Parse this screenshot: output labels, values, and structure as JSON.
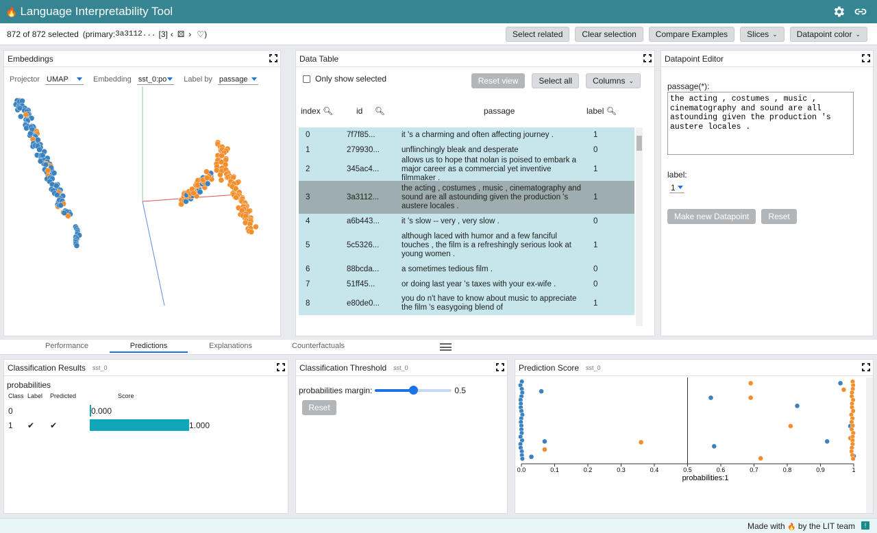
{
  "app": {
    "title": "Language Interpretability Tool",
    "logo": "flame-icon"
  },
  "status": {
    "selected_text": "872 of 872 selected",
    "primary_label": "(primary: ",
    "primary_id": "3a3112...",
    "primary_index": "[3]"
  },
  "toolbar": {
    "select_related": "Select related",
    "clear_selection": "Clear selection",
    "compare_examples": "Compare Examples",
    "slices": "Slices",
    "datapoint_color": "Datapoint color"
  },
  "embeddings": {
    "title": "Embeddings",
    "projector_label": "Projector",
    "projector_value": "UMAP",
    "embedding_label": "Embedding",
    "embedding_value": "sst_0:po",
    "label_by_label": "Label by",
    "label_by_value": "passage"
  },
  "table": {
    "title": "Data Table",
    "only_show_selected": "Only show selected",
    "reset_view": "Reset view",
    "select_all": "Select all",
    "columns": "Columns",
    "headers": {
      "index": "index",
      "id": "id",
      "passage": "passage",
      "label": "label"
    },
    "rows": [
      {
        "index": "0",
        "id": "7f7f85...",
        "passage": "it 's a charming and often affecting journey .",
        "label": "1"
      },
      {
        "index": "1",
        "id": "279930...",
        "passage": "unflinchingly bleak and desperate",
        "label": "0"
      },
      {
        "index": "2",
        "id": "345ac4...",
        "passage": "allows us to hope that nolan is poised to embark a major career as a commercial yet inventive filmmaker .",
        "label": "1"
      },
      {
        "index": "3",
        "id": "3a3112...",
        "passage": "the acting , costumes , music , cinematography and sound are all astounding given the production 's austere locales .",
        "label": "1"
      },
      {
        "index": "4",
        "id": "a6b443...",
        "passage": "it 's slow -- very , very slow .",
        "label": "0"
      },
      {
        "index": "5",
        "id": "5c5326...",
        "passage": "although laced with humor and a few fanciful touches , the film is a refreshingly serious look at young women .",
        "label": "1"
      },
      {
        "index": "6",
        "id": "88bcda...",
        "passage": "a sometimes tedious film .",
        "label": "0"
      },
      {
        "index": "7",
        "id": "51ff45...",
        "passage": "or doing last year 's taxes with your ex-wife .",
        "label": "0"
      },
      {
        "index": "8",
        "id": "e80de0...",
        "passage": "you do n't have to know about music to appreciate the film 's easygoing blend of",
        "label": "1"
      }
    ]
  },
  "editor": {
    "title": "Datapoint Editor",
    "passage_label": "passage(*):",
    "passage_value": "the acting , costumes , music , cinematography and sound are all astounding given the production 's austere locales .",
    "label_label": "label:",
    "label_value": "1",
    "make_new": "Make new Datapoint",
    "reset": "Reset"
  },
  "tabs": {
    "performance": "Performance",
    "predictions": "Predictions",
    "explanations": "Explanations",
    "counterfactuals": "Counterfactuals"
  },
  "classification": {
    "title": "Classification Results",
    "model": "sst_0",
    "field": "probabilities",
    "headers": {
      "class": "Class",
      "label": "Label",
      "predicted": "Predicted",
      "score": "Score"
    },
    "rows": [
      {
        "class": "0",
        "label": "",
        "predicted": "",
        "score": 0.0,
        "score_text": "0.000"
      },
      {
        "class": "1",
        "label": "✔",
        "predicted": "✔",
        "score": 1.0,
        "score_text": "1.000"
      }
    ]
  },
  "threshold": {
    "title": "Classification Threshold",
    "model": "sst_0",
    "slider_label": "probabilities margin:",
    "slider_value": 0.5,
    "slider_text": "0.5",
    "reset": "Reset"
  },
  "prediction": {
    "title": "Prediction Score",
    "model": "sst_0"
  },
  "footer": {
    "made_with": "Made with",
    "by": "by the LIT team"
  },
  "colors": {
    "teal": "#358593",
    "blue": "#3b83c0",
    "orange": "#f28e2b",
    "bar": "#0fa7b8"
  },
  "chart_data": {
    "type": "scatter",
    "xlabel": "probabilities:1",
    "xlim": [
      0,
      1
    ],
    "threshold": 0.5,
    "ticks": [
      "0.0",
      "0.1",
      "0.2",
      "0.3",
      "0.4",
      "0.5",
      "0.6",
      "0.7",
      "0.8",
      "0.9",
      "1"
    ],
    "points": [
      {
        "x": 0.06,
        "y": 0.12,
        "c": "blue"
      },
      {
        "x": 0.57,
        "y": 0.2,
        "c": "blue"
      },
      {
        "x": 0.69,
        "y": 0.2,
        "c": "orange"
      },
      {
        "x": 0.69,
        "y": 0.02,
        "c": "orange"
      },
      {
        "x": 0.83,
        "y": 0.3,
        "c": "blue"
      },
      {
        "x": 0.07,
        "y": 0.74,
        "c": "blue"
      },
      {
        "x": 0.07,
        "y": 0.84,
        "c": "orange"
      },
      {
        "x": 0.03,
        "y": 0.93,
        "c": "blue"
      },
      {
        "x": 0.36,
        "y": 0.75,
        "c": "orange"
      },
      {
        "x": 0.58,
        "y": 0.8,
        "c": "blue"
      },
      {
        "x": 0.72,
        "y": 0.95,
        "c": "orange"
      },
      {
        "x": 0.81,
        "y": 0.55,
        "c": "orange"
      },
      {
        "x": 0.92,
        "y": 0.74,
        "c": "blue"
      },
      {
        "x": 0.96,
        "y": 0.02,
        "c": "blue"
      },
      {
        "x": 0.97,
        "y": 0.1,
        "c": "orange"
      },
      {
        "x": 0.99,
        "y": 0.55,
        "c": "blue"
      },
      {
        "x": 0.99,
        "y": 0.7,
        "c": "orange"
      },
      {
        "x": 1.0,
        "y": 0.92,
        "c": "blue"
      }
    ]
  }
}
